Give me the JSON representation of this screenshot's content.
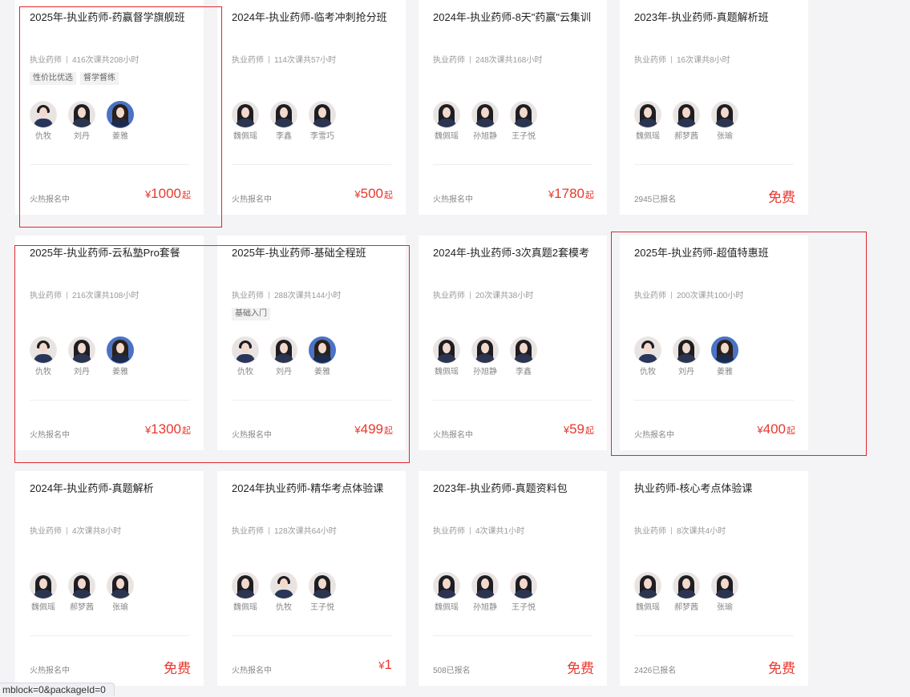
{
  "cards": [
    {
      "title": "2025年-执业药师-药赢督学旗舰班",
      "category": "执业药师",
      "stats": "416次课共208小时",
      "tags": [
        "性价比优选",
        "督学督练"
      ],
      "teachers": [
        "仇牧",
        "刘丹",
        "姜雅"
      ],
      "status": "火热报名中",
      "price": {
        "currency": "¥",
        "amount": "1000",
        "suffix": "起"
      }
    },
    {
      "title": "2024年-执业药师-临考冲刺抢分班",
      "category": "执业药师",
      "stats": "114次课共57小时",
      "tags": [],
      "teachers": [
        "魏佩瑶",
        "李鑫",
        "李雪巧"
      ],
      "status": "火热报名中",
      "price": {
        "currency": "¥",
        "amount": "500",
        "suffix": "起"
      }
    },
    {
      "title": "2024年-执业药师-8天\"药赢\"云集训",
      "category": "执业药师",
      "stats": "248次课共168小时",
      "tags": [],
      "teachers": [
        "魏佩瑶",
        "孙旭静",
        "王子悦"
      ],
      "status": "火热报名中",
      "price": {
        "currency": "¥",
        "amount": "1780",
        "suffix": "起"
      }
    },
    {
      "title": "2023年-执业药师-真题解析班",
      "category": "执业药师",
      "stats": "16次课共8小时",
      "tags": [],
      "teachers": [
        "魏佩瑶",
        "郝梦茜",
        "张瑜"
      ],
      "status": "2945已报名",
      "price": {
        "free": "免费"
      }
    },
    {
      "title": "2025年-执业药师-云私塾Pro套餐",
      "category": "执业药师",
      "stats": "216次课共108小时",
      "tags": [],
      "teachers": [
        "仇牧",
        "刘丹",
        "姜雅"
      ],
      "status": "火热报名中",
      "price": {
        "currency": "¥",
        "amount": "1300",
        "suffix": "起"
      }
    },
    {
      "title": "2025年-执业药师-基础全程班",
      "category": "执业药师",
      "stats": "288次课共144小时",
      "tags": [
        "基础入门"
      ],
      "teachers": [
        "仇牧",
        "刘丹",
        "姜雅"
      ],
      "status": "火热报名中",
      "price": {
        "currency": "¥",
        "amount": "499",
        "suffix": "起"
      }
    },
    {
      "title": "2024年-执业药师-3次真题2套模考",
      "category": "执业药师",
      "stats": "20次课共38小时",
      "tags": [],
      "teachers": [
        "魏佩瑶",
        "孙旭静",
        "李鑫"
      ],
      "status": "火热报名中",
      "price": {
        "currency": "¥",
        "amount": "59",
        "suffix": "起"
      }
    },
    {
      "title": "2025年-执业药师-超值特惠班",
      "category": "执业药师",
      "stats": "200次课共100小时",
      "tags": [],
      "teachers": [
        "仇牧",
        "刘丹",
        "姜雅"
      ],
      "status": "火热报名中",
      "price": {
        "currency": "¥",
        "amount": "400",
        "suffix": "起"
      }
    },
    {
      "title": "2024年-执业药师-真题解析",
      "category": "执业药师",
      "stats": "4次课共8小时",
      "tags": [],
      "teachers": [
        "魏佩瑶",
        "郝梦茜",
        "张瑜"
      ],
      "status": "火热报名中",
      "price": {
        "free": "免费"
      }
    },
    {
      "title": "2024年执业药师-精华考点体验课",
      "category": "执业药师",
      "stats": "128次课共64小时",
      "tags": [],
      "teachers": [
        "魏佩瑶",
        "仇牧",
        "王子悦"
      ],
      "status": "火热报名中",
      "price": {
        "currency": "¥",
        "amount": "1",
        "suffix": ""
      }
    },
    {
      "title": "2023年-执业药师-真题资料包",
      "category": "执业药师",
      "stats": "4次课共1小时",
      "tags": [],
      "teachers": [
        "魏佩瑶",
        "孙旭静",
        "王子悦"
      ],
      "status": "508已报名",
      "price": {
        "free": "免费"
      }
    },
    {
      "title": "执业药师-核心考点体验课",
      "category": "执业药师",
      "stats": "8次课共4小时",
      "tags": [],
      "teachers": [
        "魏佩瑶",
        "郝梦茜",
        "张瑜"
      ],
      "status": "2426已报名",
      "price": {
        "free": "免费"
      }
    }
  ],
  "status_bar": {
    "url": "mblock=0&packageId=0"
  }
}
